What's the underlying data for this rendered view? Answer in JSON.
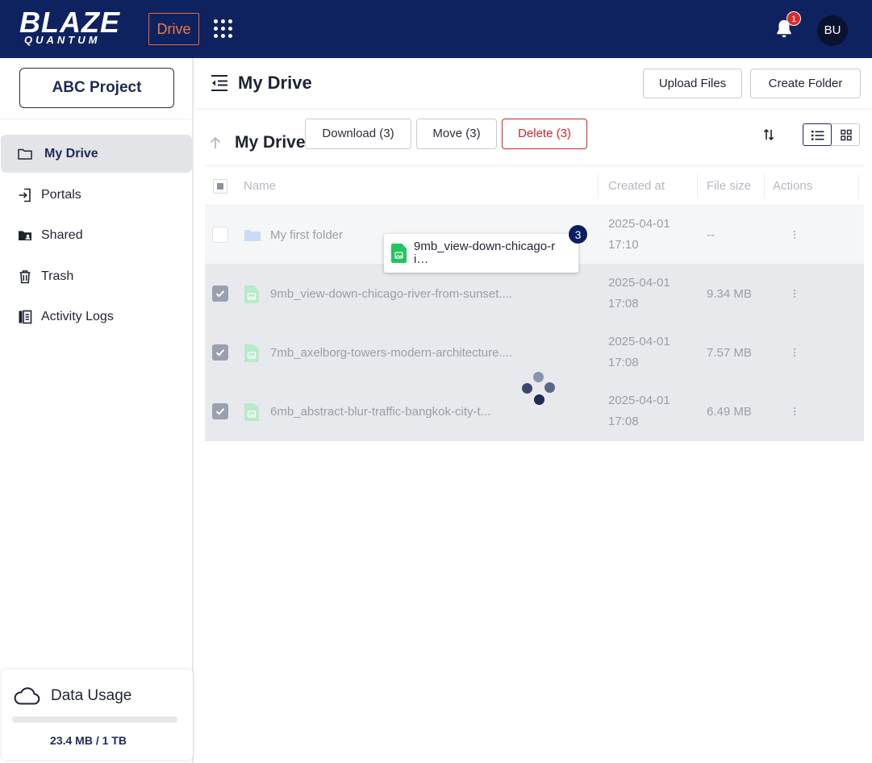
{
  "brand": {
    "line1": "BLAZE",
    "line2": "QUANTUM"
  },
  "app_chip": "Drive",
  "notifications": {
    "count": "1"
  },
  "user": {
    "initials": "BU"
  },
  "sidebar": {
    "project": "ABC Project",
    "items": [
      {
        "label": "My Drive",
        "icon": "folder-icon",
        "active": true
      },
      {
        "label": "Portals",
        "icon": "portal-enter-icon"
      },
      {
        "label": "Shared",
        "icon": "shared-folder-icon"
      },
      {
        "label": "Trash",
        "icon": "trash-icon"
      },
      {
        "label": "Activity Logs",
        "icon": "activity-log-icon"
      }
    ],
    "usage": {
      "title": "Data Usage",
      "text": "23.4 MB / 1 TB",
      "fraction": 2e-05
    }
  },
  "header": {
    "title": "My Drive",
    "upload_label": "Upload Files",
    "create_folder_label": "Create Folder"
  },
  "toolbar": {
    "title": "My Drive",
    "download_label": "Download (3)",
    "move_label": "Move (3)",
    "delete_label": "Delete (3)"
  },
  "table": {
    "columns": {
      "name": "Name",
      "created": "Created at",
      "size": "File size",
      "actions": "Actions"
    },
    "rows": [
      {
        "name": "My first folder",
        "date": "2025-04-01",
        "time": "17:10",
        "size": "--",
        "type": "folder",
        "selected": false
      },
      {
        "name": "9mb_view-down-chicago-river-from-sunset....",
        "date": "2025-04-01",
        "time": "17:08",
        "size": "9.34 MB",
        "type": "image",
        "selected": true
      },
      {
        "name": "7mb_axelborg-towers-modern-architecture....",
        "date": "2025-04-01",
        "time": "17:08",
        "size": "7.57 MB",
        "type": "image",
        "selected": true
      },
      {
        "name": "6mb_abstract-blur-traffic-bangkok-city-t...",
        "date": "2025-04-01",
        "time": "17:08",
        "size": "6.49 MB",
        "type": "image",
        "selected": true
      }
    ]
  },
  "drag": {
    "name": "9mb_view-down-chicago-ri…",
    "count": "3"
  },
  "colors": {
    "navy": "#0f2260",
    "accent": "#f07a45",
    "danger": "#c8262d",
    "file_green": "#22c55e"
  }
}
